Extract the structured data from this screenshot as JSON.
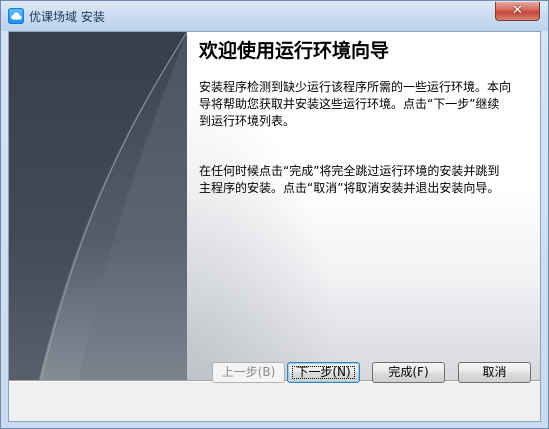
{
  "window": {
    "title": "优课场域 安装",
    "close_label": "✕"
  },
  "content": {
    "heading": "欢迎使用运行环境向导",
    "paragraph1": "安装程序检测到缺少运行该程序所需的一些运行环境。本向导将帮助您获取并安装这些运行环境。点击“下一步”继续到运行环境列表。",
    "paragraph2": "在任何时候点击“完成”将完全跳过运行环境的安装并跳到主程序的安装。点击“取消”将取消安装并退出安装向导。"
  },
  "buttons": {
    "back_label": "上一步(B)",
    "next_label": "下一步(N)",
    "finish_label": "完成(F)",
    "cancel_label": "取消"
  },
  "icons": {
    "app_icon": "cloud-icon",
    "close_icon": "close-icon"
  },
  "colors": {
    "title_bar": "#c9dbf0",
    "close_button": "#c2473a",
    "side_panel": "#3a4250",
    "default_button_border": "#3c7fb1"
  }
}
